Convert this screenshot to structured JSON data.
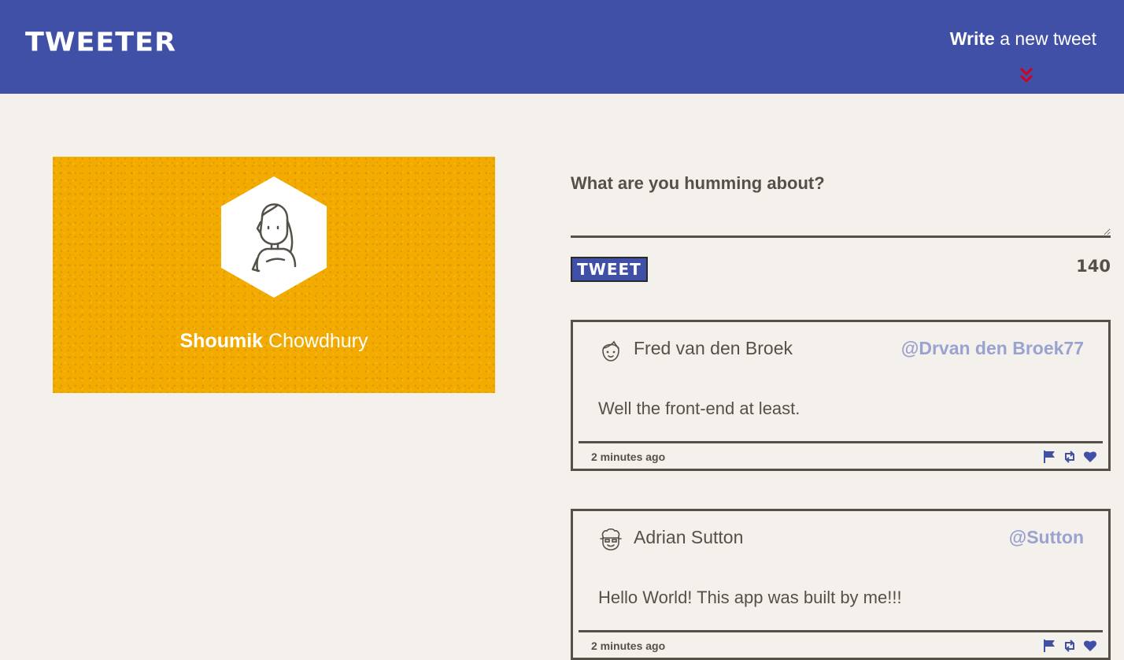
{
  "header": {
    "logo": "TWEETER",
    "compose_bold": "Write",
    "compose_rest": " a new tweet",
    "chevron_color": "#d0021b"
  },
  "profile": {
    "first_name": "Shoumik",
    "last_name": " Chowdhury",
    "background_color": "#f3ab00"
  },
  "composer": {
    "label": "What are you humming about?",
    "value": "",
    "submit_label": "TWEET",
    "counter": "140"
  },
  "tweets": [
    {
      "name": "Fred van den Broek",
      "handle": "@Drvan den Broek77",
      "content": "Well the front-end at least.",
      "time": "2 minutes ago"
    },
    {
      "name": "Adrian Sutton",
      "handle": "@Sutton",
      "content": "Hello World! This app was built by me!!!",
      "time": "2 minutes ago"
    }
  ],
  "colors": {
    "brand": "#4150a7",
    "background": "#f4f1ec",
    "text": "#545149",
    "handle": "#9aa2d0",
    "action_icons": "#4150a7"
  }
}
